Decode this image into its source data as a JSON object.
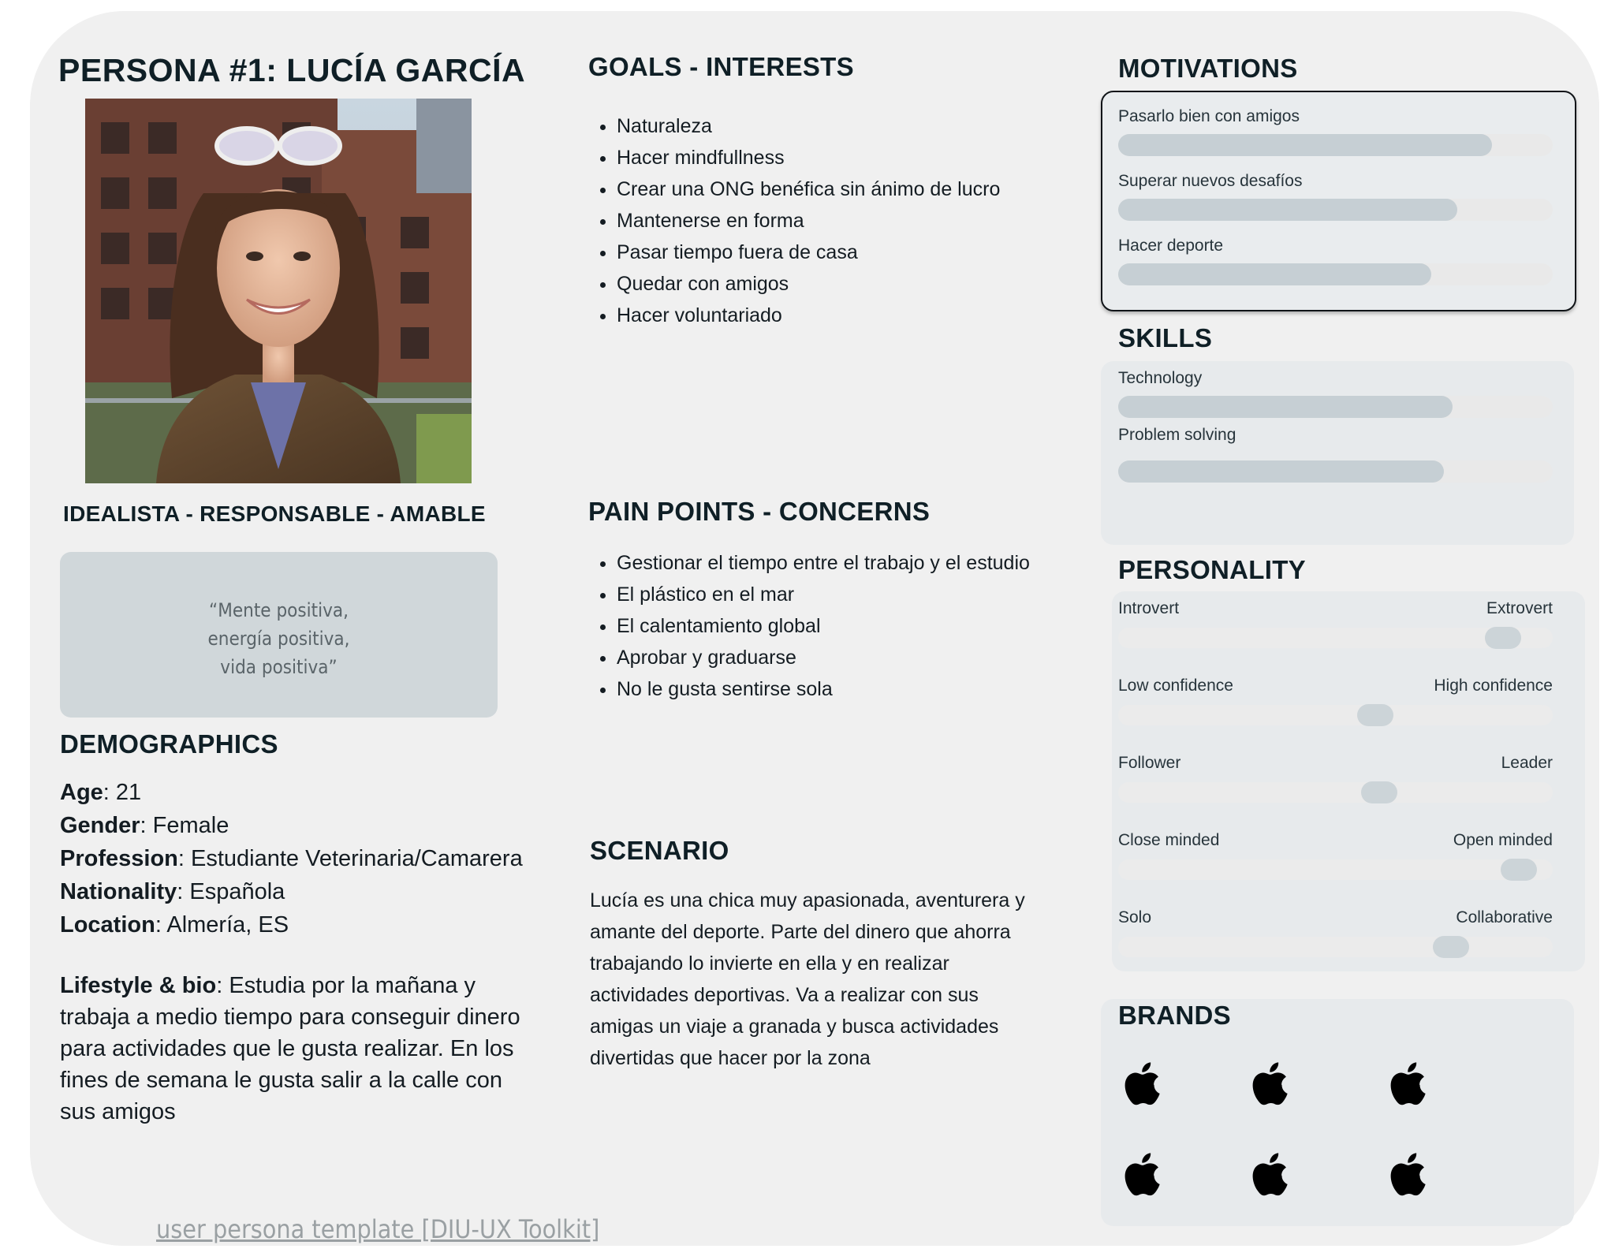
{
  "persona": {
    "title": "PERSONA #1:  LUCÍA GARCÍA",
    "traits": "IDEALISTA - RESPONSABLE - AMABLE",
    "quote_lines": [
      "“Mente positiva,",
      "energía positiva,",
      "vida positiva”"
    ]
  },
  "demographics": {
    "heading": "DEMOGRAPHICS",
    "rows": [
      {
        "label": "Age",
        "value": ": 21"
      },
      {
        "label": "Gender",
        "value": ": Female"
      },
      {
        "label": "Profession",
        "value": ": Estudiante Veterinaria/Camarera"
      },
      {
        "label": "Nationality",
        "value": ": Española"
      },
      {
        "label": "Location",
        "value": ": Almería, ES"
      }
    ],
    "bio_label": "Lifestyle & bio",
    "bio_text": ": Estudia por la mañana y trabaja a medio tiempo para conseguir dinero para actividades que le gusta realizar. En los fines de semana le gusta salir a la calle con sus amigos"
  },
  "goals": {
    "heading": "GOALS - INTERESTS",
    "items": [
      "Naturaleza",
      "Hacer mindfullness",
      "Crear una ONG benéfica sin ánimo de lucro",
      "Mantenerse en forma",
      "Pasar tiempo fuera de casa",
      "Quedar con amigos",
      "Hacer voluntariado"
    ]
  },
  "pain_points": {
    "heading": "PAIN POINTS - CONCERNS",
    "items": [
      "Gestionar el tiempo entre el trabajo y el estudio",
      "El plástico en el mar",
      "El calentamiento global",
      "Aprobar y graduarse",
      "No le gusta sentirse sola"
    ]
  },
  "scenario": {
    "heading": "SCENARIO",
    "text": "Lucía es una chica muy apasionada, aventurera y amante del deporte. Parte del dinero que ahorra trabajando lo invierte en ella y en realizar actividades deportivas. Va a realizar con sus amigas un viaje a granada y busca actividades divertidas que hacer por la zona"
  },
  "motivations": {
    "heading": "MOTIVATIONS",
    "items": [
      {
        "label": "Pasarlo bien con amigos",
        "level": 0.86
      },
      {
        "label": "Superar nuevos desafíos",
        "level": 0.78
      },
      {
        "label": "Hacer deporte",
        "level": 0.72
      }
    ]
  },
  "skills": {
    "heading": "SKILLS",
    "items": [
      {
        "label": "Technology",
        "level": 0.77
      },
      {
        "label": "Problem solving",
        "level": 0.75
      }
    ]
  },
  "personality": {
    "heading": "PERSONALITY",
    "scales": [
      {
        "left": "Introvert",
        "right": "Extrovert",
        "position": 0.92
      },
      {
        "left": "Low confidence",
        "right": "High confidence",
        "position": 0.6
      },
      {
        "left": "Follower",
        "right": "Leader",
        "position": 0.61
      },
      {
        "left": "Close minded",
        "right": "Open minded",
        "position": 0.96
      },
      {
        "left": "Solo",
        "right": "Collaborative",
        "position": 0.79
      }
    ]
  },
  "brands": {
    "heading": "BRANDS",
    "icons": [
      "apple-logo",
      "apple-logo",
      "apple-logo",
      "apple-logo",
      "apple-logo",
      "apple-logo"
    ]
  },
  "footer": {
    "link_text": "user persona template [DIU-UX Toolkit]"
  }
}
